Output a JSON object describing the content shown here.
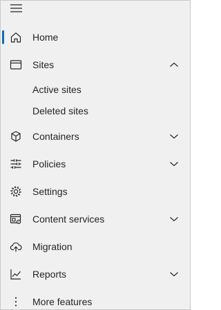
{
  "nav": {
    "accent_color": "#0f6cbd",
    "menu_icon": "hamburger-icon",
    "items": [
      {
        "label": "Home",
        "icon": "home-icon",
        "selected": true
      },
      {
        "label": "Sites",
        "icon": "browser-window-icon",
        "expanded": true,
        "children": [
          {
            "label": "Active sites"
          },
          {
            "label": "Deleted sites"
          }
        ]
      },
      {
        "label": "Containers",
        "icon": "cube-icon",
        "expanded": false
      },
      {
        "label": "Policies",
        "icon": "sliders-icon",
        "expanded": false
      },
      {
        "label": "Settings",
        "icon": "gear-icon"
      },
      {
        "label": "Content services",
        "icon": "content-services-icon",
        "expanded": false
      },
      {
        "label": "Migration",
        "icon": "cloud-upload-icon"
      },
      {
        "label": "Reports",
        "icon": "line-chart-icon",
        "expanded": false
      },
      {
        "label": "More features",
        "icon": "more-vertical-icon"
      }
    ]
  }
}
